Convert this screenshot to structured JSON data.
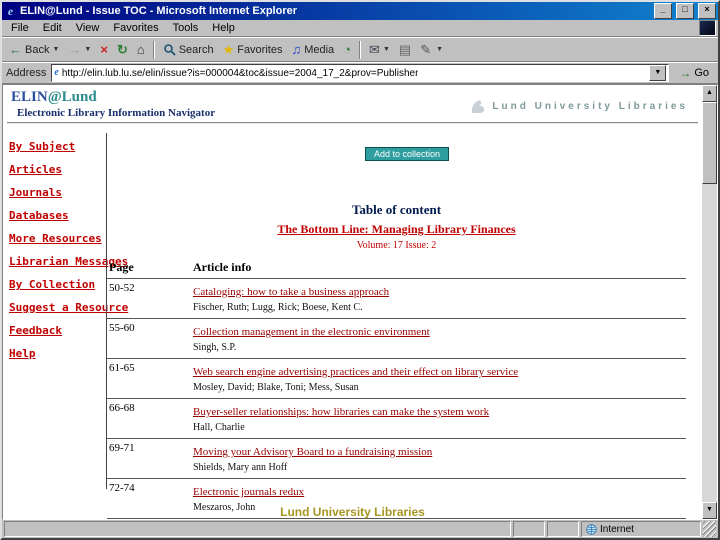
{
  "window": {
    "title": "ELIN@Lund - Issue TOC - Microsoft Internet Explorer",
    "minimize": "_",
    "maximize": "□",
    "close": "×"
  },
  "icons": {
    "ie_e": "e",
    "back": "←",
    "forward": "→",
    "stop": "×",
    "refresh": "↻",
    "home": "⌂",
    "favorites": "★",
    "media": "♫",
    "history": "◔",
    "mail": "✉",
    "print": "▤",
    "edit": "✎",
    "dropdown": "▼",
    "go": "→",
    "scroll_up": "▲",
    "scroll_down": "▼"
  },
  "menu": {
    "items": [
      "File",
      "Edit",
      "View",
      "Favorites",
      "Tools",
      "Help"
    ]
  },
  "toolbar": {
    "back_label": "Back",
    "search_label": "Search",
    "favorites_label": "Favorites",
    "media_label": "Media"
  },
  "address": {
    "label": "Address",
    "value": "http://elin.lub.lu.se/elin/issue?is=000004&toc&issue=2004_17_2&prov=Publisher",
    "go_label": "Go"
  },
  "page": {
    "brand_elin": "ELIN",
    "brand_lund": "@Lund",
    "brand_subtitle": "Electronic Library Information Navigator",
    "header_right": "Lund University Libraries",
    "sidebar": [
      "By Subject",
      "Articles",
      "Journals",
      "Databases",
      "More Resources",
      "Librarian Messages",
      "By Collection",
      "Suggest a Resource",
      "Feedback",
      "Help"
    ],
    "add_button": "Add to collection",
    "toc_title": "Table of content",
    "journal_title": "The Bottom Line: Managing Library Finances",
    "issue_info": "Volume: 17 Issue: 2",
    "table": {
      "headers": [
        "Page",
        "Article info"
      ],
      "rows": [
        {
          "pages": "50-52",
          "title": "Cataloging: how to take a business approach",
          "authors": "Fischer, Ruth; Lugg, Rick; Boese, Kent C."
        },
        {
          "pages": "55-60",
          "title": "Collection management in the electronic environment",
          "authors": "Singh, S.P."
        },
        {
          "pages": "61-65",
          "title": "Web search engine advertising practices and their effect on library service",
          "authors": "Mosley, David; Blake, Toni; Mess, Susan"
        },
        {
          "pages": "66-68",
          "title": "Buyer-seller relationships: how libraries can make the system work",
          "authors": "Hall, Charlie"
        },
        {
          "pages": "69-71",
          "title": "Moving your Advisory Board to a fundraising mission",
          "authors": "Shields, Mary ann Hoff"
        },
        {
          "pages": "72-74",
          "title": "Electronic journals redux",
          "authors": "Meszaros, John"
        }
      ]
    },
    "footer": "Lund University Libraries"
  },
  "statusbar": {
    "zone": "Internet"
  }
}
